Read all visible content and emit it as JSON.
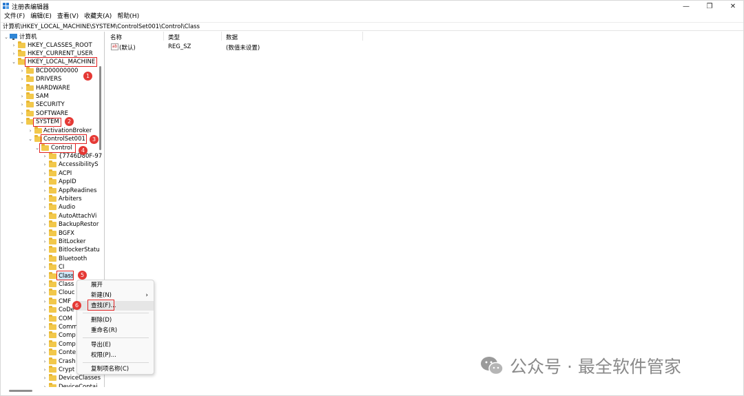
{
  "window": {
    "title": "注册表编辑器",
    "controls": {
      "minimize": "—",
      "restore": "❐",
      "close": "✕"
    }
  },
  "menu": [
    "文件(F)",
    "编辑(E)",
    "查看(V)",
    "收藏夹(A)",
    "帮助(H)"
  ],
  "address": "计算机\\HKEY_LOCAL_MACHINE\\SYSTEM\\ControlSet001\\Control\\Class",
  "tree": {
    "root": "计算机",
    "hives": [
      "HKEY_CLASSES_ROOT",
      "HKEY_CURRENT_USER",
      "HKEY_LOCAL_MACHINE"
    ],
    "hklm_children": [
      "BCD00000000",
      "DRIVERS",
      "HARDWARE",
      "SAM",
      "SECURITY",
      "SOFTWARE",
      "SYSTEM"
    ],
    "system_children": [
      "ActivationBroker",
      "ControlSet001"
    ],
    "controlset_children": [
      "Control"
    ],
    "control_children": [
      "{7746D80F-97",
      "AccessibilityS",
      "ACPI",
      "AppID",
      "AppReadines",
      "Arbiters",
      "Audio",
      "AutoAttachVi",
      "BackupRestor",
      "BGFX",
      "BitLocker",
      "BitlockerStatu",
      "Bluetooth",
      "CI",
      "Class",
      "Class",
      "Clouc",
      "CMF",
      "CoDe",
      "COM",
      "Comm",
      "Comp",
      "Comp",
      "Conte",
      "Crash",
      "Crypt",
      "DeviceClasses",
      "DeviceContai"
    ]
  },
  "list": {
    "headers": {
      "name": "名称",
      "type": "类型",
      "data": "数据"
    },
    "rows": [
      {
        "name": "(默认)",
        "type": "REG_SZ",
        "data": "(数值未设置)",
        "icon": "ab"
      }
    ]
  },
  "context_menu": {
    "items": [
      "展开",
      "新建(N)",
      "查找(F)...",
      "删除(D)",
      "重命名(R)",
      "导出(E)",
      "权限(P)...",
      "复制项名称(C)"
    ]
  },
  "annotations": [
    "1",
    "2",
    "3",
    "4",
    "5",
    "6"
  ],
  "watermark": "公众号 · 最全软件管家",
  "colors": {
    "highlight": "#e02020",
    "badge": "#e53935",
    "folder": "#f2c84b",
    "menu_hover": "#e6e6e6"
  }
}
